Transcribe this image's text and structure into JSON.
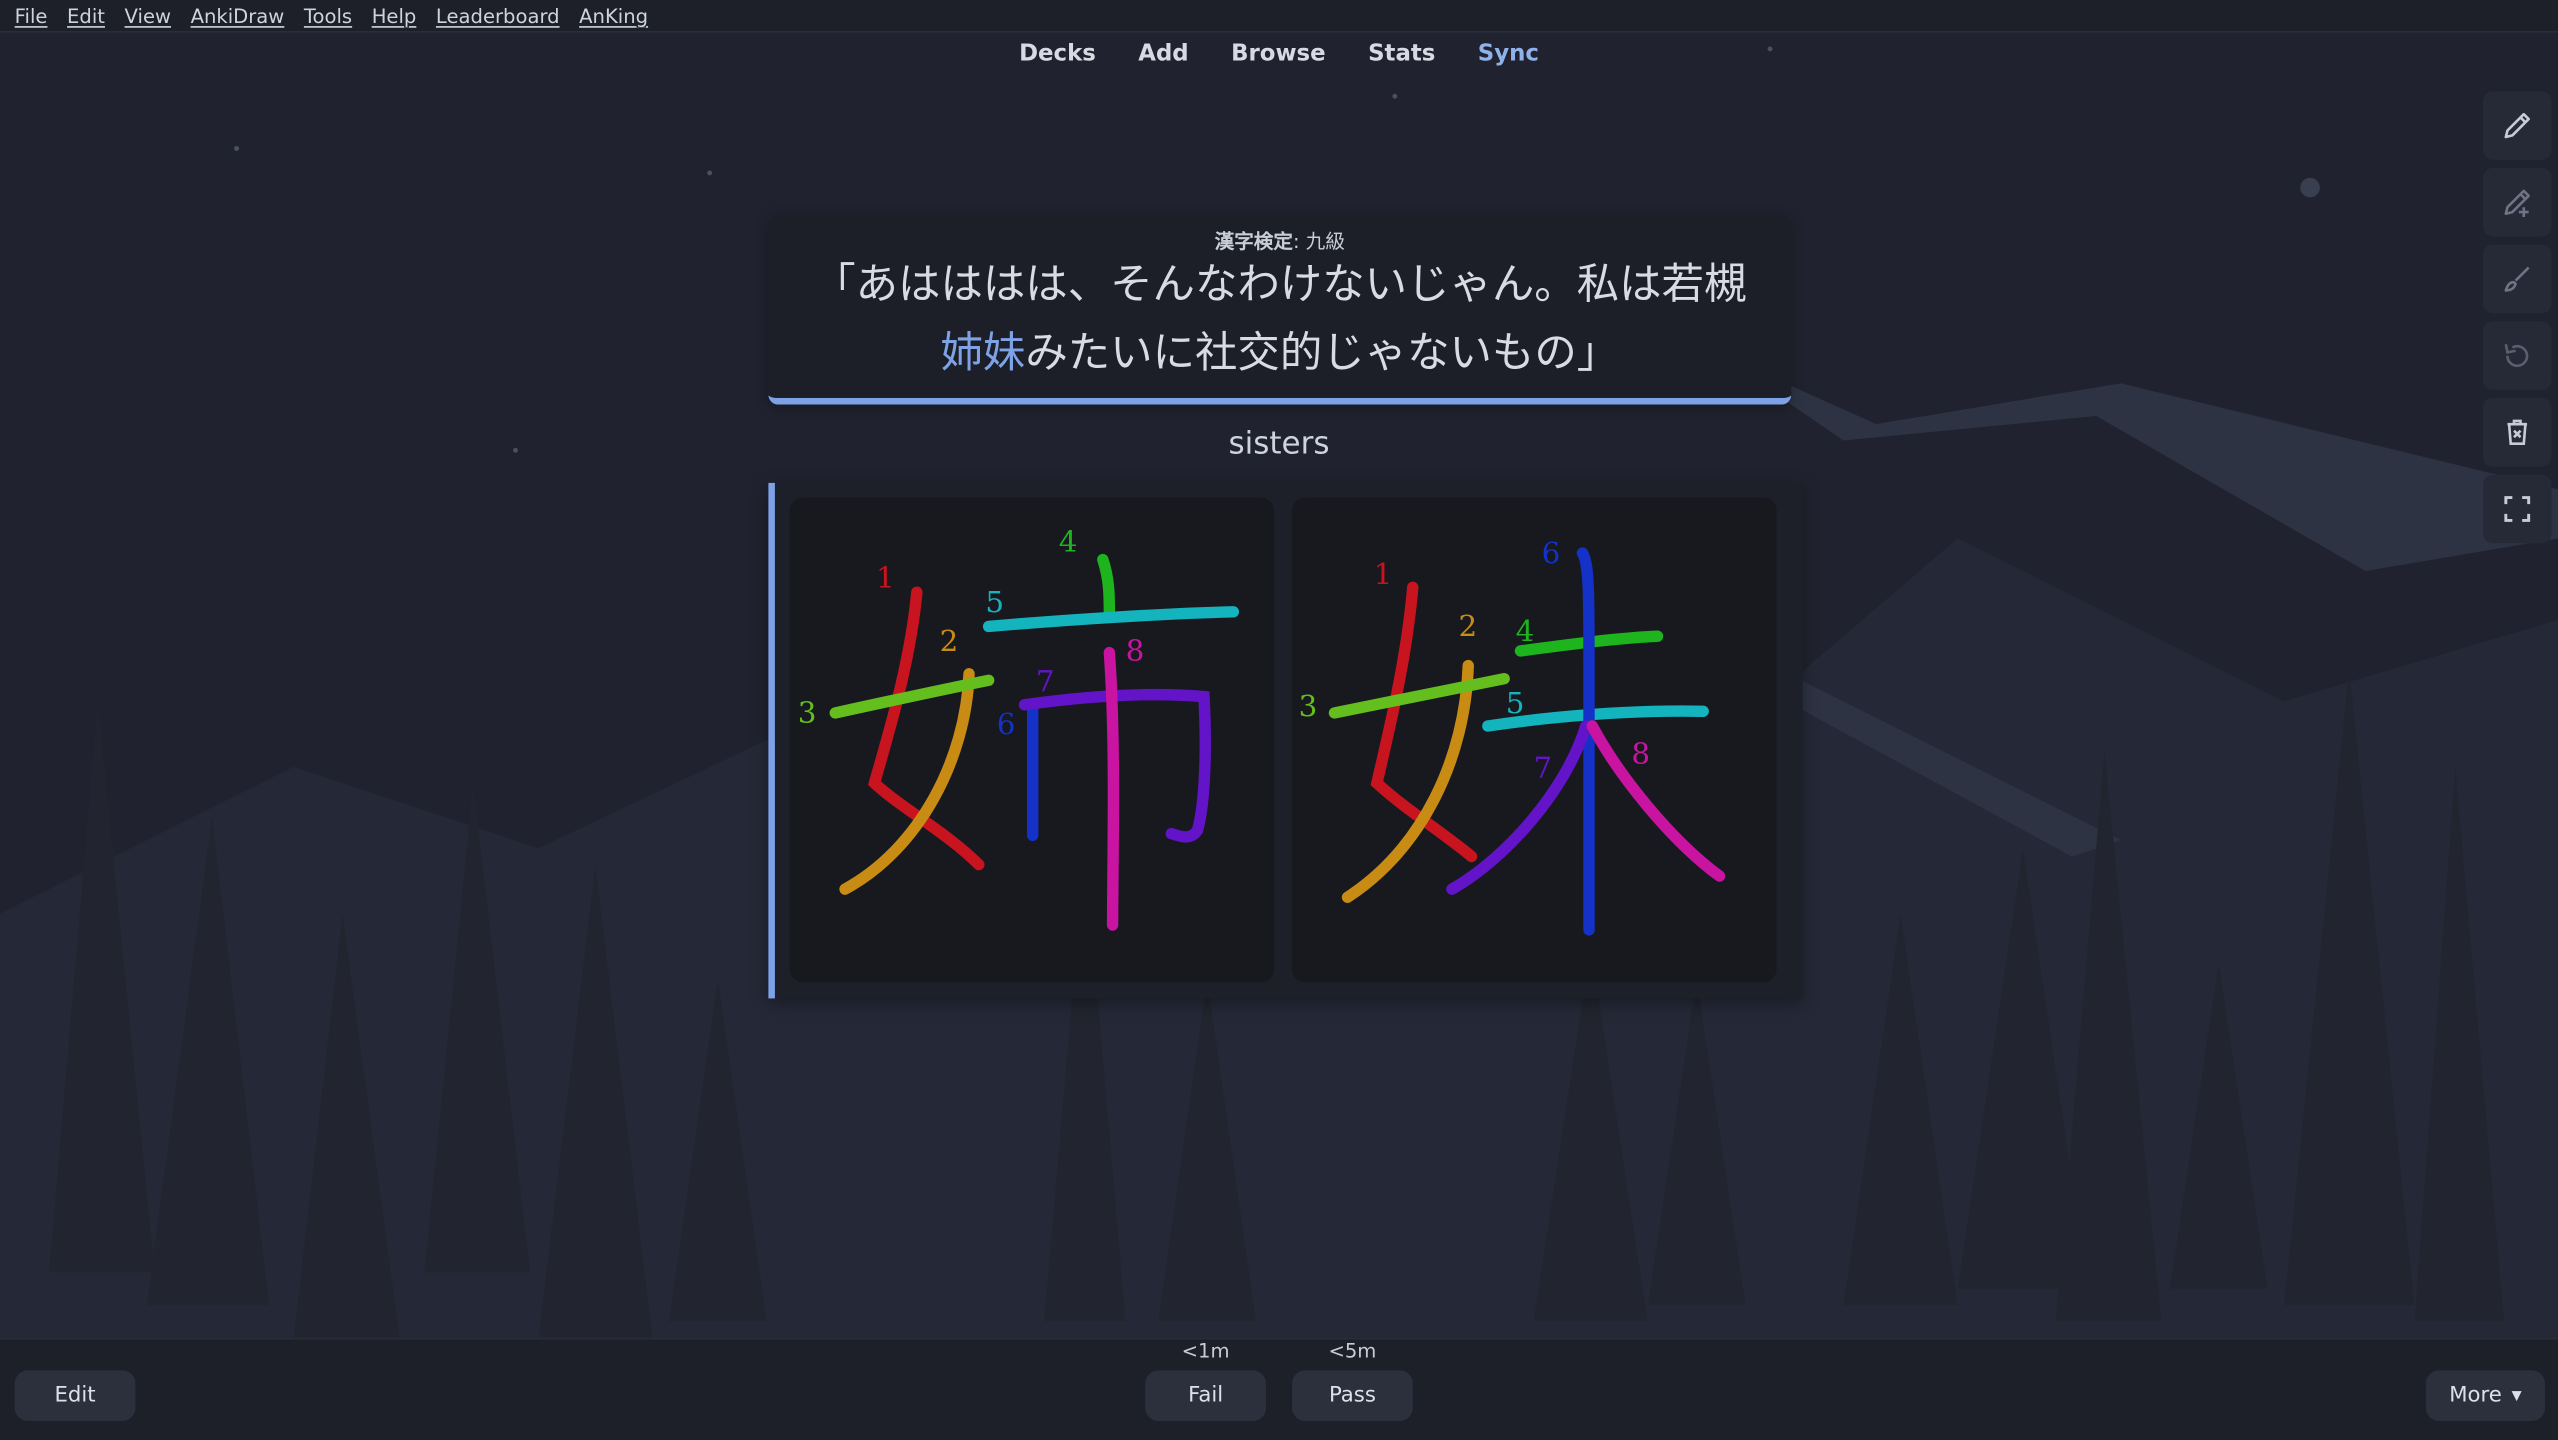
{
  "menu": [
    "File",
    "Edit",
    "View",
    "AnkiDraw",
    "Tools",
    "Help",
    "Leaderboard",
    "AnKing"
  ],
  "nav": {
    "decks": "Decks",
    "add": "Add",
    "browse": "Browse",
    "stats": "Stats",
    "sync": "Sync"
  },
  "tools": [
    "pencil-icon",
    "pencil-plus-icon",
    "brush-icon",
    "undo-icon",
    "trash-icon",
    "fullscreen-icon"
  ],
  "card": {
    "kanken_label": "漢字検定",
    "kanken_sep": ": ",
    "kanken_level": "九級",
    "sentence_line1": "「あはははは、そんなわけないじゃん。私は若槻",
    "sentence_highlight": "姉妹",
    "sentence_line2_rest": "みたいに社交的じゃないもの」",
    "meaning": "sisters"
  },
  "stroke_order": {
    "kanji_left": "姉",
    "kanji_right": "妹",
    "left_labels": [
      "1",
      "2",
      "3",
      "4",
      "5",
      "6",
      "7",
      "8"
    ],
    "right_labels": [
      "1",
      "2",
      "3",
      "4",
      "5",
      "6",
      "7",
      "8"
    ]
  },
  "bottom": {
    "edit": "Edit",
    "fail": "Fail",
    "fail_interval": "<1m",
    "pass": "Pass",
    "pass_interval": "<5m",
    "more": "More",
    "more_caret": "▼"
  },
  "colors": {
    "accent": "#7ea2e6",
    "background": "#20232f",
    "stroke1": "#c8141e",
    "stroke2": "#c88c14",
    "stroke3": "#64be1e",
    "stroke4": "#1eb41e",
    "stroke5": "#14b4be",
    "stroke6": "#1432c8",
    "stroke7": "#6414c8",
    "stroke8": "#c814a0"
  }
}
